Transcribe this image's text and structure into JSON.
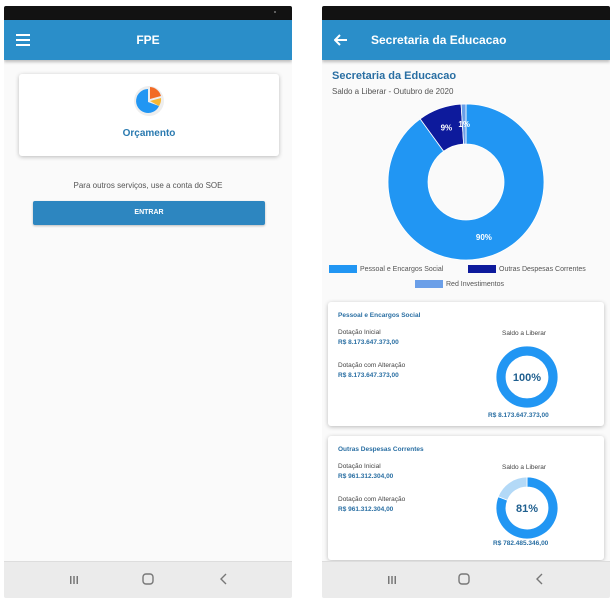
{
  "left": {
    "title": "FPE",
    "card_label": "Orçamento",
    "soe_text": "Para outros serviços, use a conta do SOE",
    "button_label": "ENTRAR"
  },
  "right": {
    "appbar_title": "Secretaria da Educacao",
    "heading": "Secretaria da Educacao",
    "subtitle": "Saldo a Liberar - Outubro de 2020",
    "cards": [
      {
        "title": "Pessoal e Encargos Social",
        "dot_ini_label": "Dotação Inicial",
        "dot_ini_value": "R$ 8.173.647.373,00",
        "dot_alt_label": "Dotação com Alteração",
        "dot_alt_value": "R$ 8.173.647.373,00",
        "saldo_label": "Saldo a Liberar",
        "pct": "100%",
        "saldo_value": "R$ 8.173.647.373,00"
      },
      {
        "title": "Outras Despesas Correntes",
        "dot_ini_label": "Dotação Inicial",
        "dot_ini_value": "R$ 961.312.304,00",
        "dot_alt_label": "Dotação com Alteração",
        "dot_alt_value": "R$ 961.312.304,00",
        "saldo_label": "Saldo a Liberar",
        "pct": "81%",
        "saldo_value": "R$ 782.485.346,00"
      }
    ]
  },
  "chart_data": [
    {
      "type": "pie",
      "title": "",
      "categories": [
        "Pessoal e Encargos Social",
        "Outras Despesas Correntes",
        "Red Investimentos"
      ],
      "values": [
        90,
        9,
        1
      ],
      "labels": [
        "90%",
        "9%",
        "1%"
      ],
      "colors": [
        "#2196f3",
        "#0d1a9c",
        "#6b9fe8"
      ],
      "legend": "bottom"
    },
    {
      "type": "pie",
      "values": [
        100,
        0
      ],
      "colors": [
        "#2196f3",
        "#b3d9f7"
      ],
      "center_label": "100%"
    },
    {
      "type": "pie",
      "values": [
        81,
        19
      ],
      "colors": [
        "#2196f3",
        "#b3d9f7"
      ],
      "center_label": "81%"
    }
  ],
  "icons": [
    "menu-icon",
    "pie-chart-icon",
    "back-arrow-icon",
    "recent-apps-icon",
    "home-icon",
    "back-icon"
  ]
}
